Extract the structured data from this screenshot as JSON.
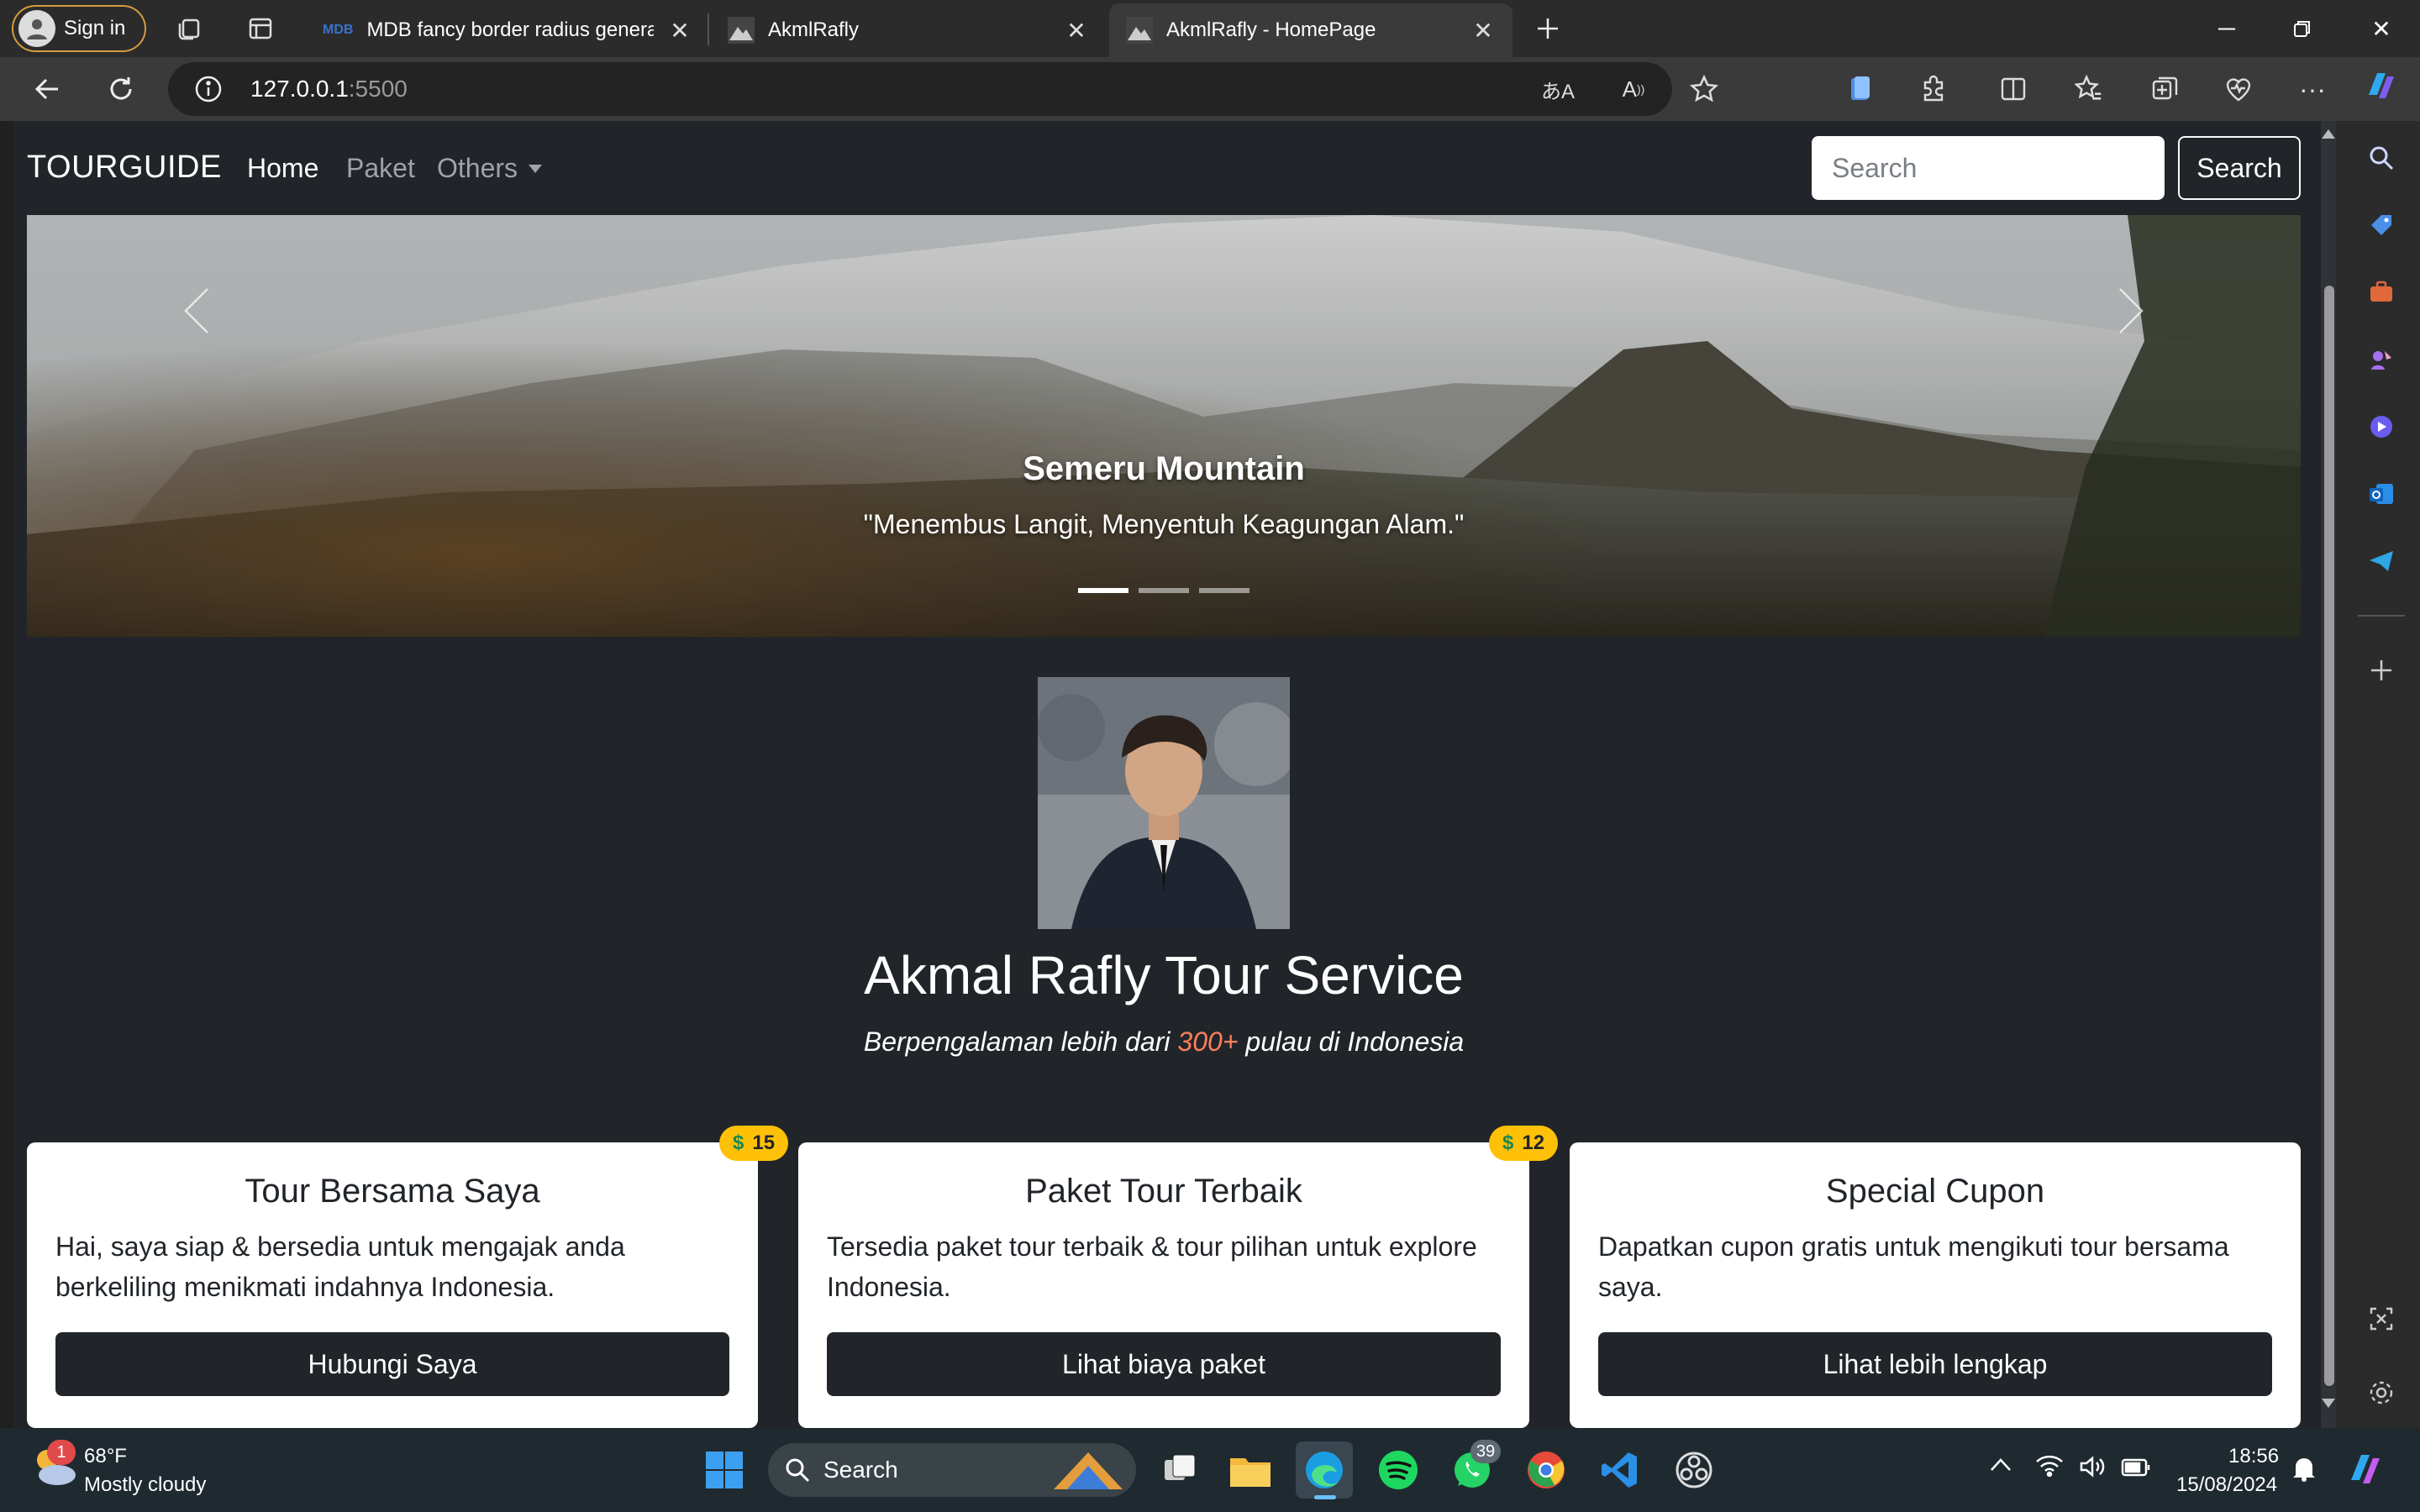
{
  "browser": {
    "signin_label": "Sign in",
    "tabs": [
      {
        "title": "MDB fancy border radius generat",
        "icon": "mdb-icon"
      },
      {
        "title": "AkmlRafly",
        "icon": "site-icon"
      },
      {
        "title": "AkmlRafly - HomePage",
        "icon": "site-icon"
      }
    ],
    "url_host": "127.0.0.1",
    "url_port": ":5500"
  },
  "site": {
    "brand": "TOURGUIDE",
    "nav": {
      "home": "Home",
      "paket": "Paket",
      "others": "Others"
    },
    "search_placeholder": "Search",
    "search_button": "Search",
    "carousel": {
      "title": "Semeru Mountain",
      "text": "\"Menembus Langit, Menyentuh Keagungan Alam.\"",
      "slide_count": 3,
      "active_slide": 1
    },
    "profile": {
      "heading": "Akmal Rafly Tour Service",
      "lead_before": "Berpengalaman lebih dari ",
      "lead_highlight": "300+",
      "lead_after": " pulau di Indonesia"
    },
    "cards": [
      {
        "title": "Tour Bersama Saya",
        "text": "Hai, saya siap & bersedia untuk mengajak anda berkeliling menikmati indahnya Indonesia.",
        "button": "Hubungi Saya",
        "badge": "15"
      },
      {
        "title": "Paket Tour Terbaik",
        "text": "Tersedia paket tour terbaik & tour pilihan untuk explore Indonesia.",
        "button": "Lihat biaya paket",
        "badge": "12"
      },
      {
        "title": "Special Cupon",
        "text": "Dapatkan cupon gratis untuk mengikuti tour bersama saya.",
        "button": "Lihat lebih lengkap"
      }
    ]
  },
  "taskbar": {
    "weather_temp": "68°F",
    "weather_desc": "Mostly cloudy",
    "weather_badge": "1",
    "search_label": "Search",
    "whatsapp_badge": "39",
    "time": "18:56",
    "date": "15/08/2024"
  },
  "colors": {
    "accent_highlight": "#fd7e5a",
    "badge": "#ffc107",
    "page_bg": "#212529"
  }
}
